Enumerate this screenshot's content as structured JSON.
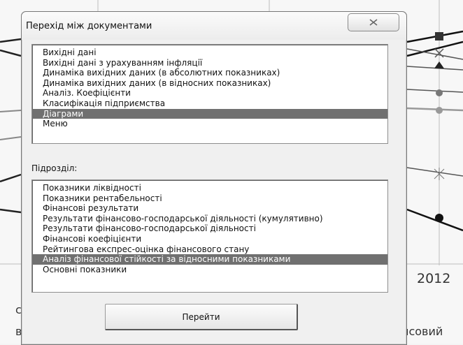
{
  "background": {
    "year_label": "2012",
    "cut_text_right": "нсовий",
    "cut_text_left_top": "с",
    "cut_text_left_bottom": "в"
  },
  "dialog": {
    "title": "Перехід між документами",
    "close_icon": "close-icon",
    "documents": {
      "items": [
        "Вихідні дані",
        "Вихідні дані з урахуванням інфляції",
        "Динаміка вихідних даних (в абсолютних показниках)",
        "Динаміка вихідних даних (в відносних показниках)",
        "Аналіз. Коефіцієнти",
        "Класифікація підприємства",
        "Діаграми",
        "Меню"
      ],
      "selected": "Діаграми"
    },
    "subsection_label": "Підрозділ:",
    "subsections": {
      "items": [
        "Показники ліквідності",
        "Показники рентабельності",
        "Фінансові результати",
        "Результати фінансово-господарської діяльності (кумулятивно)",
        "Результати фінансово-господарської діяльності",
        "Фінансові коефіцієнти",
        "Рейтингова експрес-оцінка фінансового стану",
        "Аналіз фінансової стійкості за відносними показниками",
        "Основні показники"
      ],
      "selected": "Аналіз фінансової стійкості за відносними показниками"
    },
    "go_button_label": "Перейти"
  },
  "colors": {
    "selection": "#707070",
    "window": "#f0f0f0"
  }
}
